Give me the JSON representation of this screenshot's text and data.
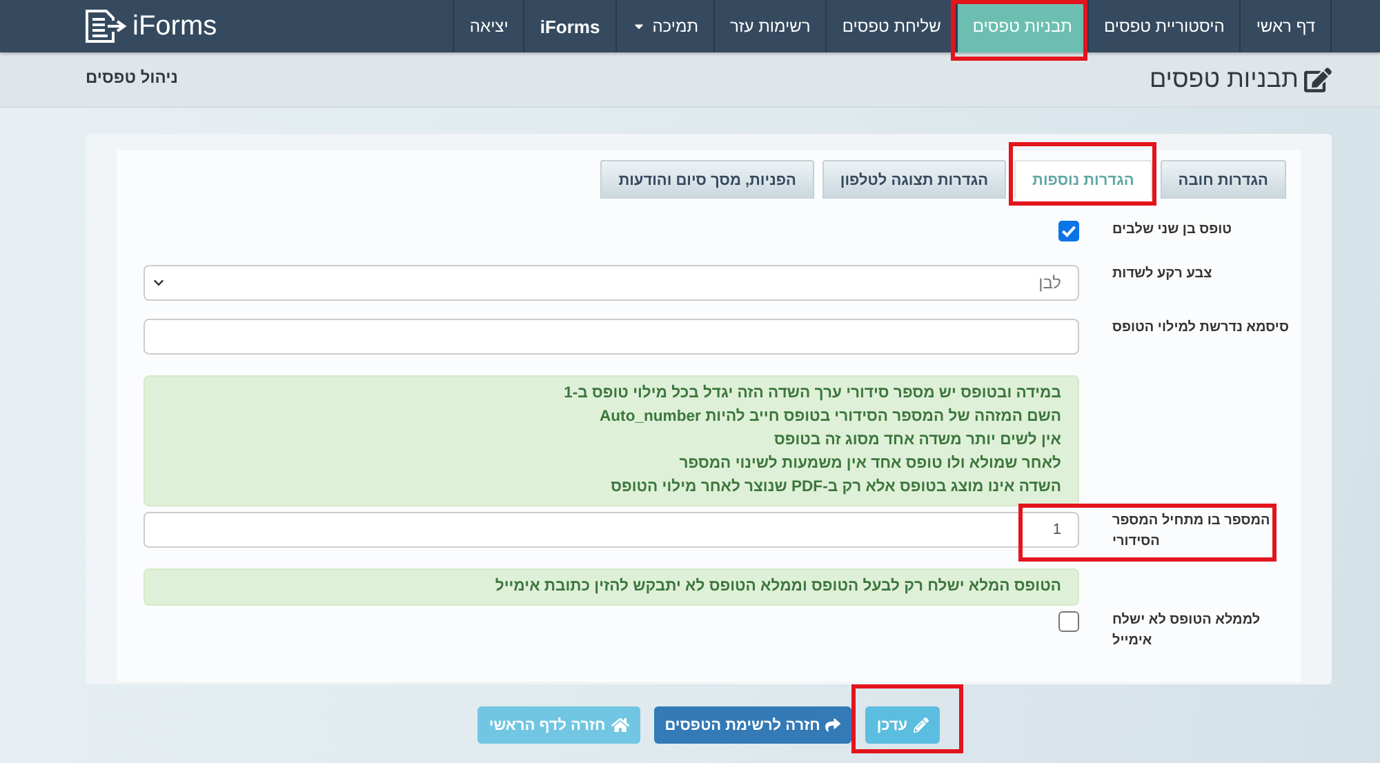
{
  "navbar": {
    "logo": "iForms",
    "items": [
      {
        "label": "דף ראשי",
        "kind": "link",
        "selected": false,
        "highlighted": false
      },
      {
        "label": "היסטוריית טפסים",
        "kind": "link",
        "selected": false,
        "highlighted": false
      },
      {
        "label": "תבניות טפסים",
        "kind": "link",
        "selected": true,
        "highlighted": true
      },
      {
        "label": "שליחת טפסים",
        "kind": "link",
        "selected": false,
        "highlighted": false
      },
      {
        "label": "רשימות עזר",
        "kind": "link",
        "selected": false,
        "highlighted": false
      },
      {
        "label": "תמיכה",
        "kind": "dropdown",
        "selected": false,
        "highlighted": false
      },
      {
        "label": "iForms",
        "kind": "brand",
        "selected": false,
        "highlighted": false
      },
      {
        "label": "יציאה",
        "kind": "link",
        "selected": false,
        "highlighted": false
      }
    ]
  },
  "header": {
    "title": "תבניות טפסים",
    "breadcrumb": "ניהול טפסים"
  },
  "tabs": [
    {
      "label": "הגדרות חובה",
      "selected": false,
      "highlighted": false
    },
    {
      "label": "הגדרות נוספות",
      "selected": true,
      "highlighted": true
    },
    {
      "label": "הגדרות תצוגה לטלפון",
      "selected": false,
      "highlighted": false
    },
    {
      "label": "הפניות, מסך סיום והודעות",
      "selected": false,
      "highlighted": false
    }
  ],
  "form": {
    "rows": [
      {
        "kind": "checkbox",
        "label": "טופס בן שני שלבים",
        "checked": true,
        "highlighted": false
      },
      {
        "kind": "select",
        "label": "צבע רקע לשדות",
        "value": "לבן",
        "highlighted": false
      },
      {
        "kind": "input",
        "label": "סיסמא נדרשת למילוי הטופס",
        "highlighted": false
      },
      {
        "kind": "alert",
        "lines": [
          "במידה ובטופס יש מספר סידורי ערך השדה הזה יגדל בכל מילוי טופס ב-1",
          "השם המזהה של המספר הסידורי בטופס חייב להיות Auto_number",
          "אין לשים יותר משדה אחד מסוג זה בטופס",
          "לאחר שמולא ולו טופס אחד אין משמעות לשינוי המספר",
          "השדה אינו מוצג בטופס אלא רק ב-PDF שנוצר לאחר מילוי הטופס"
        ],
        "highlighted": false
      },
      {
        "kind": "input",
        "label": "המספר בו מתחיל המספר הסידורי",
        "value": "1",
        "highlighted": true
      },
      {
        "kind": "alert",
        "lines": [
          "הטופס המלא ישלח רק לבעל הטופס וממלא הטופס לא יתבקש להזין כתובת אימייל"
        ],
        "highlighted": false
      },
      {
        "kind": "checkbox",
        "label": "לממלא הטופס לא ישלח אימייל",
        "checked": false,
        "highlighted": false
      }
    ]
  },
  "buttons": [
    {
      "label": "עדכן",
      "kind": "update",
      "highlighted": true
    },
    {
      "label": "חזרה לרשימת הטפסים",
      "kind": "list",
      "highlighted": false
    },
    {
      "label": "חזרה לדף הראשי",
      "kind": "home",
      "highlighted": false
    }
  ]
}
